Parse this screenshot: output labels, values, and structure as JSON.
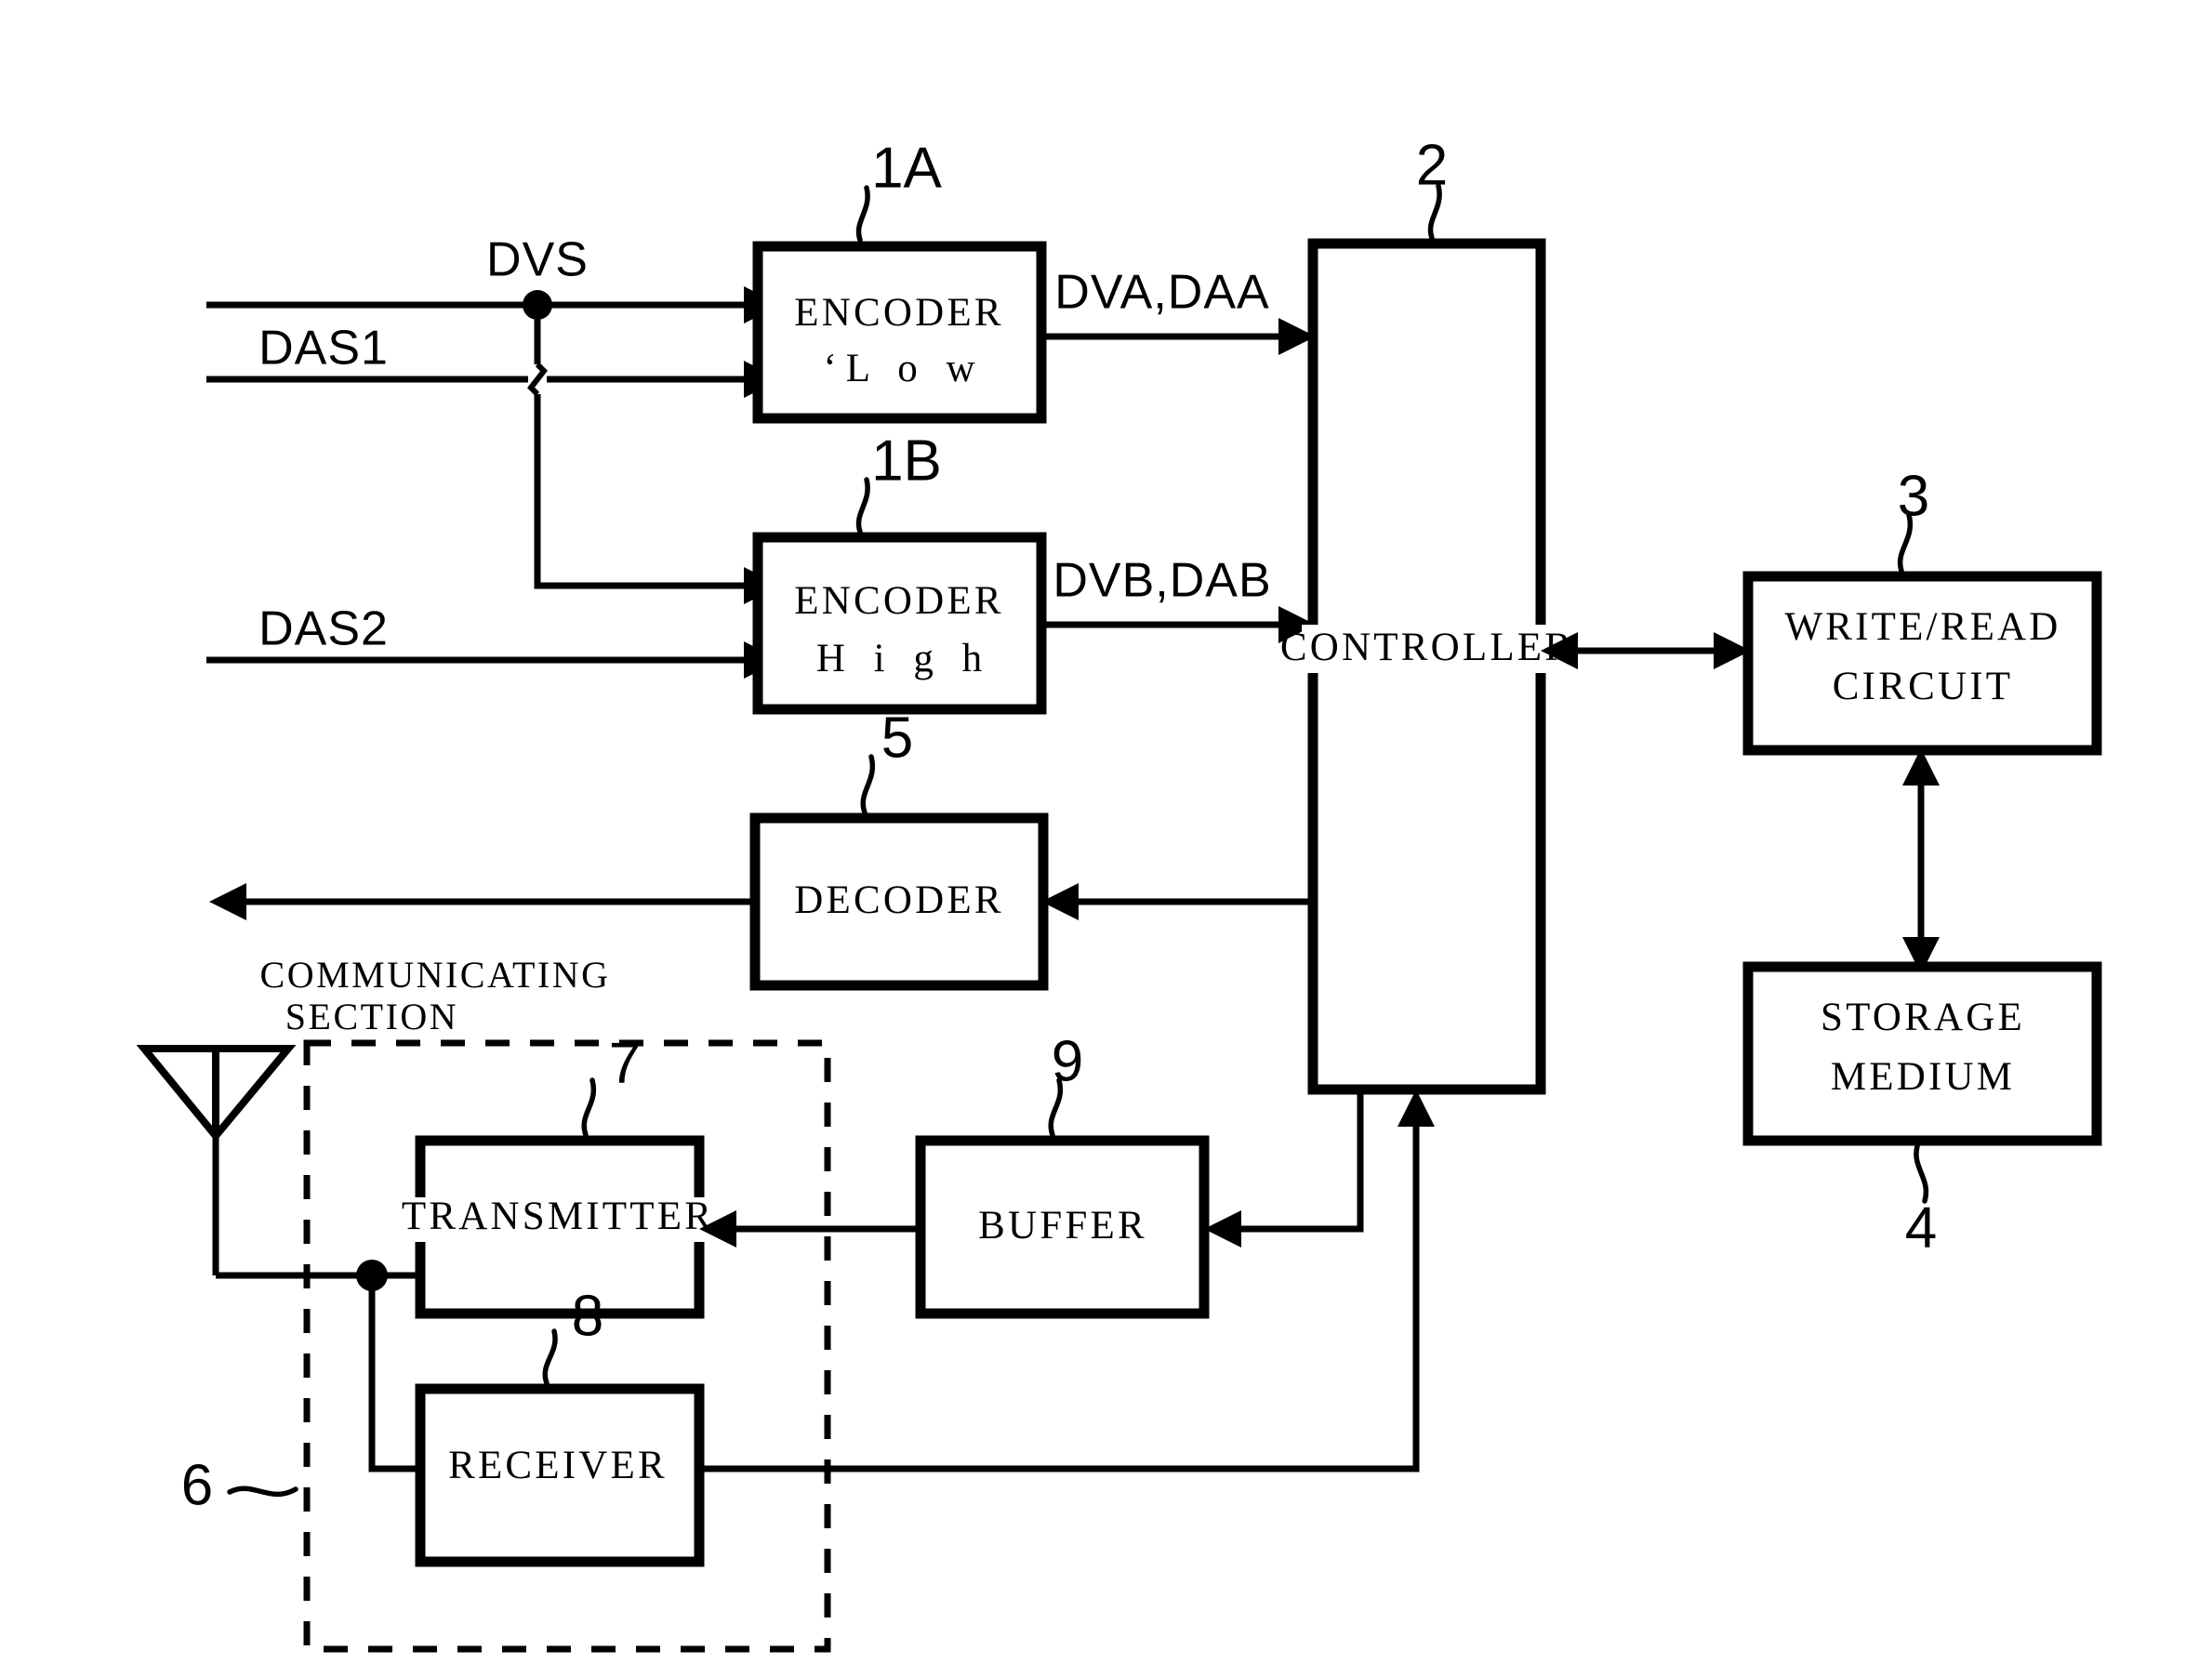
{
  "figure": {
    "type": "patent-block-diagram",
    "background_color": "#ffffff",
    "line_color": "#000000"
  },
  "blocks": {
    "encoder_low": {
      "line1": "ENCODER",
      "line2": "‘L o w",
      "ref": "1A"
    },
    "encoder_high": {
      "line1": "ENCODER",
      "line2": "H i g h",
      "ref": "1B"
    },
    "controller": {
      "label": "CONTROLLER",
      "ref": "2"
    },
    "write_read_circuit": {
      "line1": "WRITE/READ",
      "line2": "CIRCUIT",
      "ref": "3"
    },
    "storage_medium": {
      "line1": "STORAGE",
      "line2": "MEDIUM",
      "ref": "4"
    },
    "decoder": {
      "label": "DECODER",
      "ref": "5"
    },
    "communicating_section": {
      "line1": "COMMUNICATING",
      "line2": "SECTION",
      "ref": "6"
    },
    "transmitter": {
      "label": "TRANSMITTER",
      "ref": "7"
    },
    "receiver": {
      "label": "RECEIVER",
      "ref": "8"
    },
    "buffer": {
      "label": "BUFFER",
      "ref": "9"
    }
  },
  "signals": {
    "dvs": "DVS",
    "das1": "DAS1",
    "das2": "DAS2",
    "dva_daa": "DVA,DAA",
    "dvb_dab": "DVB,DAB"
  },
  "icons": {
    "antenna": "antenna-icon"
  }
}
